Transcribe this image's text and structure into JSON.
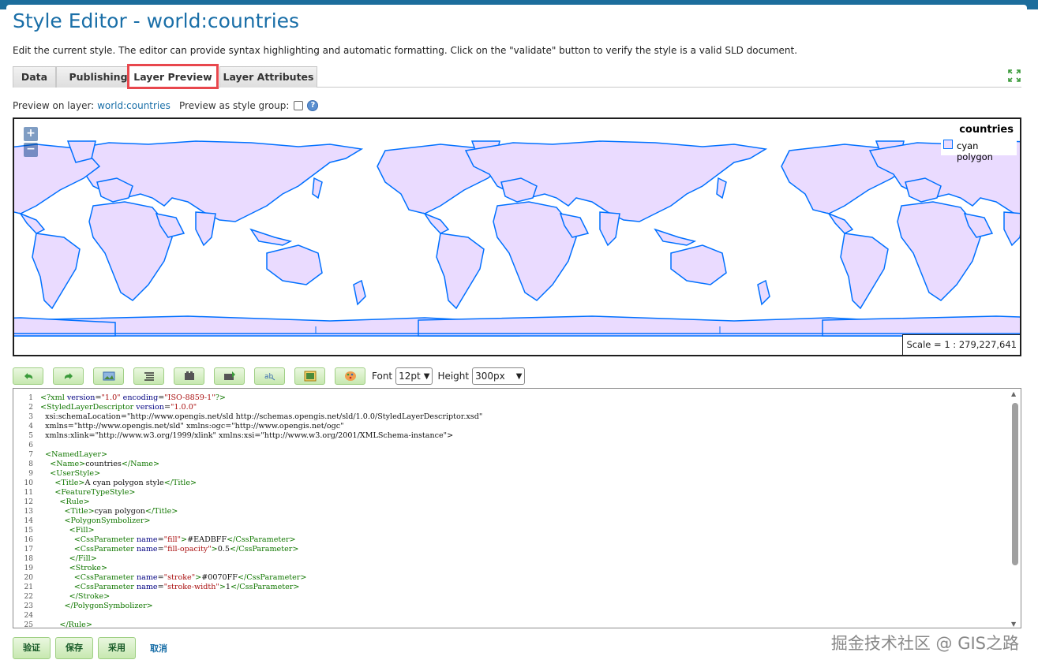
{
  "header": {
    "title": "Style Editor - world:countries",
    "description": "Edit the current style. The editor can provide syntax highlighting and automatic formatting. Click on the \"validate\" button to verify the style is a valid SLD document."
  },
  "tabs": [
    {
      "label": "Data"
    },
    {
      "label": "Publishing"
    },
    {
      "label": "Layer Preview"
    },
    {
      "label": "Layer Attributes"
    }
  ],
  "active_tab": "Layer Preview",
  "preview": {
    "layer_label": "Preview on layer:",
    "layer_value": "world:countries",
    "group_label": "Preview as style group:",
    "group_checked": false
  },
  "map": {
    "zoom_in": "+",
    "zoom_out": "−",
    "legend_title": "countries",
    "legend_item": "cyan polygon",
    "fill_color": "#EADBFF",
    "stroke_color": "#0070FF",
    "scale_text": "Scale = 1 : 279,227,641"
  },
  "toolbar": {
    "icons": [
      "undo-icon",
      "redo-icon",
      "insert-image-icon",
      "reformat-icon",
      "color-picker-icon",
      "find-replace-icon",
      "replace-icon",
      "chart-icon",
      "palette-icon"
    ],
    "font_label": "Font",
    "font_value": "12pt",
    "height_label": "Height",
    "height_value": "300px"
  },
  "code": {
    "lines": [
      {
        "n": "1",
        "text": "<?xml version=\"1.0\" encoding=\"ISO-8859-1\"?>"
      },
      {
        "n": "2",
        "text": "<StyledLayerDescriptor version=\"1.0.0\""
      },
      {
        "n": "3",
        "text": "  xsi:schemaLocation=\"http://www.opengis.net/sld http://schemas.opengis.net/sld/1.0.0/StyledLayerDescriptor.xsd\""
      },
      {
        "n": "4",
        "text": "  xmlns=\"http://www.opengis.net/sld\" xmlns:ogc=\"http://www.opengis.net/ogc\""
      },
      {
        "n": "5",
        "text": "  xmlns:xlink=\"http://www.w3.org/1999/xlink\" xmlns:xsi=\"http://www.w3.org/2001/XMLSchema-instance\">"
      },
      {
        "n": "6",
        "text": ""
      },
      {
        "n": "7",
        "text": "  <NamedLayer>"
      },
      {
        "n": "8",
        "text": "    <Name>countries</Name>"
      },
      {
        "n": "9",
        "text": "    <UserStyle>"
      },
      {
        "n": "10",
        "text": "      <Title>A cyan polygon style</Title>"
      },
      {
        "n": "11",
        "text": "      <FeatureTypeStyle>"
      },
      {
        "n": "12",
        "text": "        <Rule>"
      },
      {
        "n": "13",
        "text": "          <Title>cyan polygon</Title>"
      },
      {
        "n": "14",
        "text": "          <PolygonSymbolizer>"
      },
      {
        "n": "15",
        "text": "            <Fill>"
      },
      {
        "n": "16",
        "text": "              <CssParameter name=\"fill\">#EADBFF</CssParameter>"
      },
      {
        "n": "17",
        "text": "              <CssParameter name=\"fill-opacity\">0.5</CssParameter>"
      },
      {
        "n": "18",
        "text": "            </Fill>"
      },
      {
        "n": "19",
        "text": "            <Stroke>"
      },
      {
        "n": "20",
        "text": "              <CssParameter name=\"stroke\">#0070FF</CssParameter>"
      },
      {
        "n": "21",
        "text": "              <CssParameter name=\"stroke-width\">1</CssParameter>"
      },
      {
        "n": "22",
        "text": "            </Stroke>"
      },
      {
        "n": "23",
        "text": "          </PolygonSymbolizer>"
      },
      {
        "n": "24",
        "text": ""
      },
      {
        "n": "25",
        "text": "        </Rule>"
      }
    ]
  },
  "actions": {
    "validate": "验证",
    "save": "保存",
    "apply": "采用",
    "cancel": "取消"
  },
  "watermark": "掘金技术社区 @ GIS之路"
}
